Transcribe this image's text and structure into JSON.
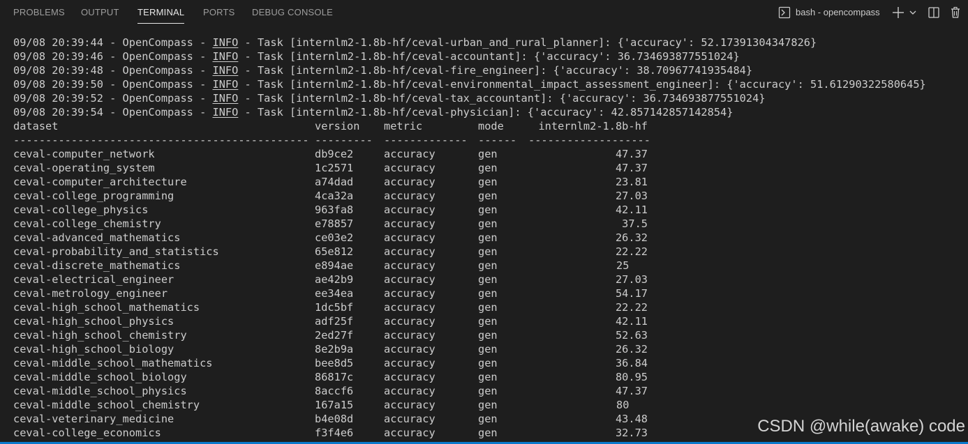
{
  "tabs": [
    {
      "label": "PROBLEMS"
    },
    {
      "label": "OUTPUT"
    },
    {
      "label": "TERMINAL",
      "active": true
    },
    {
      "label": "PORTS"
    },
    {
      "label": "DEBUG CONSOLE"
    }
  ],
  "terminal_selector": {
    "label": "bash - opencompass",
    "icon": "terminal-icon"
  },
  "actions": {
    "new_terminal_icon": "plus-icon",
    "dropdown_icon": "chevron-down-icon",
    "split_icon": "split-terminal-icon",
    "kill_icon": "trash-icon"
  },
  "log_lines": [
    {
      "prefix": "09/08 20:39:44 - OpenCompass - ",
      "level": "INFO",
      "message": " - Task [internlm2-1.8b-hf/ceval-urban_and_rural_planner]: {'accuracy': 52.17391304347826}"
    },
    {
      "prefix": "09/08 20:39:46 - OpenCompass - ",
      "level": "INFO",
      "message": " - Task [internlm2-1.8b-hf/ceval-accountant]: {'accuracy': 36.734693877551024}"
    },
    {
      "prefix": "09/08 20:39:48 - OpenCompass - ",
      "level": "INFO",
      "message": " - Task [internlm2-1.8b-hf/ceval-fire_engineer]: {'accuracy': 38.70967741935484}"
    },
    {
      "prefix": "09/08 20:39:50 - OpenCompass - ",
      "level": "INFO",
      "message": " - Task [internlm2-1.8b-hf/ceval-environmental_impact_assessment_engineer]: {'accuracy': 51.61290322580645}"
    },
    {
      "prefix": "09/08 20:39:52 - OpenCompass - ",
      "level": "INFO",
      "message": " - Task [internlm2-1.8b-hf/ceval-tax_accountant]: {'accuracy': 36.734693877551024}"
    },
    {
      "prefix": "09/08 20:39:54 - OpenCompass - ",
      "level": "INFO",
      "message": " - Task [internlm2-1.8b-hf/ceval-physician]: {'accuracy': 42.857142857142854}"
    }
  ],
  "table": {
    "headers": {
      "dataset": "dataset",
      "version": "version",
      "metric": "metric",
      "mode": "mode",
      "score": "internlm2-1.8b-hf"
    },
    "separators": {
      "dataset": "----------------------------------------------",
      "version": "---------",
      "metric": "-------------",
      "mode": "------",
      "score": "-------------------"
    },
    "rows": [
      {
        "dataset": "ceval-computer_network",
        "version": "db9ce2",
        "metric": "accuracy",
        "mode": "gen",
        "score": "47.37"
      },
      {
        "dataset": "ceval-operating_system",
        "version": "1c2571",
        "metric": "accuracy",
        "mode": "gen",
        "score": "47.37"
      },
      {
        "dataset": "ceval-computer_architecture",
        "version": "a74dad",
        "metric": "accuracy",
        "mode": "gen",
        "score": "23.81"
      },
      {
        "dataset": "ceval-college_programming",
        "version": "4ca32a",
        "metric": "accuracy",
        "mode": "gen",
        "score": "27.03"
      },
      {
        "dataset": "ceval-college_physics",
        "version": "963fa8",
        "metric": "accuracy",
        "mode": "gen",
        "score": "42.11"
      },
      {
        "dataset": "ceval-college_chemistry",
        "version": "e78857",
        "metric": "accuracy",
        "mode": "gen",
        "score": "37.5"
      },
      {
        "dataset": "ceval-advanced_mathematics",
        "version": "ce03e2",
        "metric": "accuracy",
        "mode": "gen",
        "score": "26.32"
      },
      {
        "dataset": "ceval-probability_and_statistics",
        "version": "65e812",
        "metric": "accuracy",
        "mode": "gen",
        "score": "22.22"
      },
      {
        "dataset": "ceval-discrete_mathematics",
        "version": "e894ae",
        "metric": "accuracy",
        "mode": "gen",
        "score": "25"
      },
      {
        "dataset": "ceval-electrical_engineer",
        "version": "ae42b9",
        "metric": "accuracy",
        "mode": "gen",
        "score": "27.03"
      },
      {
        "dataset": "ceval-metrology_engineer",
        "version": "ee34ea",
        "metric": "accuracy",
        "mode": "gen",
        "score": "54.17"
      },
      {
        "dataset": "ceval-high_school_mathematics",
        "version": "1dc5bf",
        "metric": "accuracy",
        "mode": "gen",
        "score": "22.22"
      },
      {
        "dataset": "ceval-high_school_physics",
        "version": "adf25f",
        "metric": "accuracy",
        "mode": "gen",
        "score": "42.11"
      },
      {
        "dataset": "ceval-high_school_chemistry",
        "version": "2ed27f",
        "metric": "accuracy",
        "mode": "gen",
        "score": "52.63"
      },
      {
        "dataset": "ceval-high_school_biology",
        "version": "8e2b9a",
        "metric": "accuracy",
        "mode": "gen",
        "score": "26.32"
      },
      {
        "dataset": "ceval-middle_school_mathematics",
        "version": "bee8d5",
        "metric": "accuracy",
        "mode": "gen",
        "score": "36.84"
      },
      {
        "dataset": "ceval-middle_school_biology",
        "version": "86817c",
        "metric": "accuracy",
        "mode": "gen",
        "score": "80.95"
      },
      {
        "dataset": "ceval-middle_school_physics",
        "version": "8accf6",
        "metric": "accuracy",
        "mode": "gen",
        "score": "47.37"
      },
      {
        "dataset": "ceval-middle_school_chemistry",
        "version": "167a15",
        "metric": "accuracy",
        "mode": "gen",
        "score": "80"
      },
      {
        "dataset": "ceval-veterinary_medicine",
        "version": "b4e08d",
        "metric": "accuracy",
        "mode": "gen",
        "score": "43.48"
      },
      {
        "dataset": "ceval-college_economics",
        "version": "f3f4e6",
        "metric": "accuracy",
        "mode": "gen",
        "score": "32.73"
      }
    ]
  },
  "watermark": "CSDN @while(awake) code",
  "colors": {
    "background": "#1e1e1e",
    "text": "#cccccc",
    "active_tab": "#e7e7e7",
    "inactive_tab": "#9d9d9d",
    "accent": "#0a7acc"
  }
}
